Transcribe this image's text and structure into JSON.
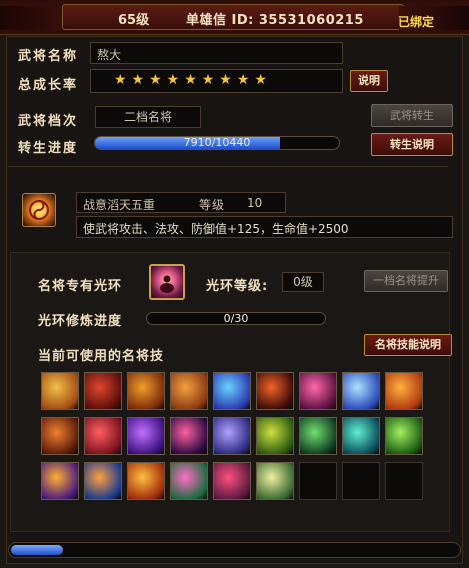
{
  "header": {
    "level": "65级",
    "id_text": "单雄信 ID: 35531060215",
    "bound": "已绑定"
  },
  "general": {
    "name_label": "武将名称",
    "name_value": "熬大",
    "growth_label": "总成长率",
    "growth_stars": 9,
    "growth_stars_text": "★★★★★★★★★",
    "explain_button": "说明",
    "grade_label": "武将档次",
    "grade_value": "二档名将",
    "rebirth_button": "武将转生",
    "rebirth_progress_label": "转生进度",
    "rebirth_progress_text": "7910/10440",
    "rebirth_progress": 0.758,
    "rebirth_explain_button": "转生说明"
  },
  "buff": {
    "name": "战意滔天五重",
    "level_label": "等级",
    "level_value": "10",
    "description": "使武将攻击、法攻、防御值+125，生命值+2500"
  },
  "aura": {
    "exclusive_label": "名将专有光环",
    "level_label": "光环等级:",
    "level_value": "0级",
    "upgrade_button": "一档名将提升",
    "train_label": "光环修炼进度",
    "train_progress_text": "0/30",
    "train_progress": 0,
    "skills_label": "当前可使用的名将技",
    "skills_explain_button": "名将技能说明"
  },
  "skills": [
    {
      "icon": "sword-slash-icon",
      "c1": "#f3c24a",
      "c2": "#a14b12"
    },
    {
      "icon": "red-slash-icon",
      "c1": "#e0472e",
      "c2": "#5a0e0a"
    },
    {
      "icon": "golden-swords-icon",
      "c1": "#f0a02a",
      "c2": "#7a2b0b"
    },
    {
      "icon": "hammer-strike-icon",
      "c1": "#f6a040",
      "c2": "#8a3a12"
    },
    {
      "icon": "blue-wave-icon",
      "c1": "#6ad2ff",
      "c2": "#2a3ab0"
    },
    {
      "icon": "fire-demon-icon",
      "c1": "#f2642a",
      "c2": "#3a0a08"
    },
    {
      "icon": "pink-wings-icon",
      "c1": "#ff6aa8",
      "c2": "#5a1040"
    },
    {
      "icon": "blue-shield-icon",
      "c1": "#aee2ff",
      "c2": "#2a4ab8"
    },
    {
      "icon": "flame-bird-icon",
      "c1": "#ffb040",
      "c2": "#b03a10"
    },
    {
      "icon": "dragon-icon",
      "c1": "#f08030",
      "c2": "#5a1a0a"
    },
    {
      "icon": "hearts-icon",
      "c1": "#ff6060",
      "c2": "#7a1020"
    },
    {
      "icon": "purple-swirl-icon",
      "c1": "#c070ff",
      "c2": "#3a1080"
    },
    {
      "icon": "dark-flame-icon",
      "c1": "#ff60a0",
      "c2": "#2a0a40"
    },
    {
      "icon": "spiral-icon",
      "c1": "#b0a0ff",
      "c2": "#2a2a80"
    },
    {
      "icon": "green-burst-icon",
      "c1": "#d0e040",
      "c2": "#2a5a10"
    },
    {
      "icon": "warrior-green-icon",
      "c1": "#70e070",
      "c2": "#103a20"
    },
    {
      "icon": "teal-figure-icon",
      "c1": "#60f0d0",
      "c2": "#0a4a5a"
    },
    {
      "icon": "green-leaf-icon",
      "c1": "#a0f060",
      "c2": "#1a5a10"
    },
    {
      "icon": "purple-figure-icon",
      "c1": "#ffb030",
      "c2": "#4a1a80"
    },
    {
      "icon": "blue-warrior-icon",
      "c1": "#ffa040",
      "c2": "#1a3a90"
    },
    {
      "icon": "fire-tower-icon",
      "c1": "#ffc040",
      "c2": "#a02a0a"
    },
    {
      "icon": "magenta-gate-icon",
      "c1": "#ff70c0",
      "c2": "#1a6a40"
    },
    {
      "icon": "pink-burst-icon",
      "c1": "#ff5080",
      "c2": "#5a1a40"
    },
    {
      "icon": "light-figure-icon",
      "c1": "#f0f0a0",
      "c2": "#3a6a30"
    }
  ],
  "empty_slots": 3,
  "colors": {
    "accent_red": "#6b1a14",
    "gold": "#f6c53d",
    "progress_blue": "#2351c9",
    "bound_yellow": "#ffdd44"
  }
}
